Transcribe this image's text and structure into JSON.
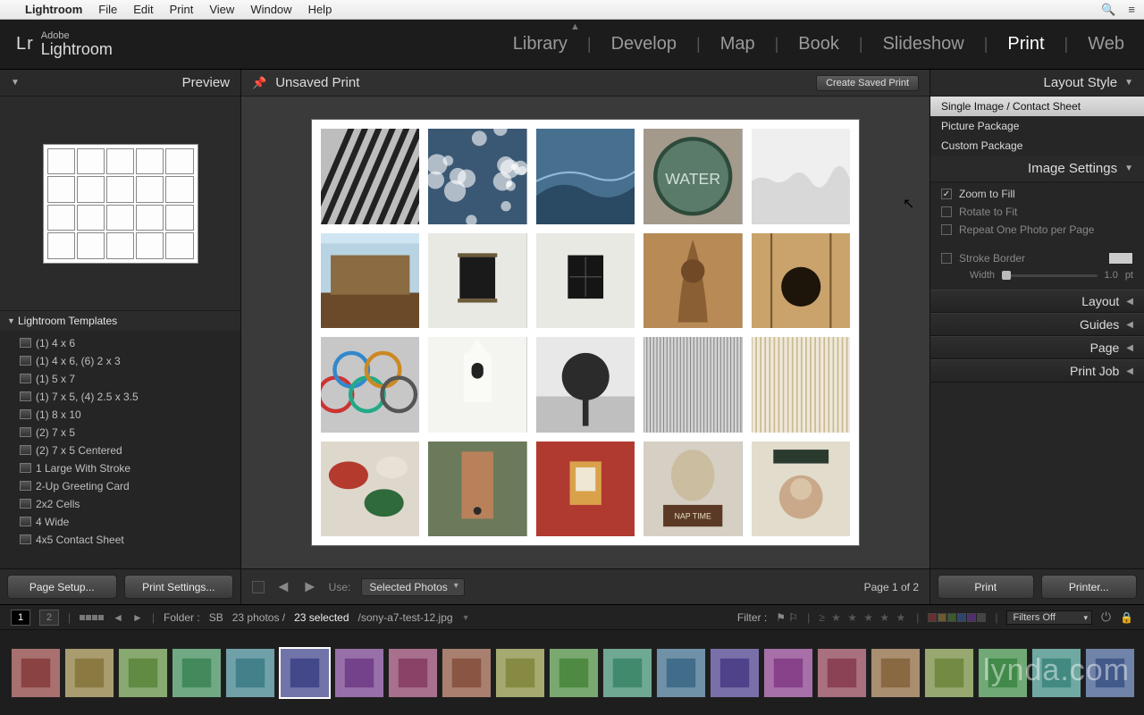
{
  "menubar": {
    "items": [
      "Lightroom",
      "File",
      "Edit",
      "Print",
      "View",
      "Window",
      "Help"
    ]
  },
  "app": {
    "adobe": "Adobe",
    "product": "Lightroom",
    "mark": "Lr"
  },
  "modules": [
    "Library",
    "Develop",
    "Map",
    "Book",
    "Slideshow",
    "Print",
    "Web"
  ],
  "modules_active": "Print",
  "left": {
    "preview_title": "Preview",
    "templates_group": "Lightroom Templates",
    "templates": [
      "(1) 4 x 6",
      "(1) 4 x 6, (6) 2 x 3",
      "(1) 5 x 7",
      "(1) 7 x 5, (4) 2.5 x 3.5",
      "(1) 8 x 10",
      "(2) 7 x 5",
      "(2) 7 x 5 Centered",
      "1 Large With Stroke",
      "2-Up Greeting Card",
      "2x2 Cells",
      "4 Wide",
      "4x5 Contact Sheet"
    ],
    "page_setup": "Page Setup...",
    "print_settings": "Print Settings..."
  },
  "center": {
    "doc_title": "Unsaved Print",
    "create_saved": "Create Saved Print",
    "use_label": "Use:",
    "use_value": "Selected Photos",
    "page_indicator": "Page 1 of 2"
  },
  "right": {
    "layout_style_title": "Layout Style",
    "layout_styles": [
      "Single Image / Contact Sheet",
      "Picture Package",
      "Custom Package"
    ],
    "layout_style_selected": 0,
    "image_settings_title": "Image Settings",
    "zoom_to_fill": "Zoom to Fill",
    "rotate_to_fit": "Rotate to Fit",
    "repeat_one": "Repeat One Photo per Page",
    "stroke_border": "Stroke Border",
    "width_label": "Width",
    "width_value": "1.0",
    "width_unit": "pt",
    "sections": [
      "Layout",
      "Guides",
      "Page",
      "Print Job"
    ],
    "print_btn": "Print",
    "printer_btn": "Printer..."
  },
  "filmstrip": {
    "folder_label": "Folder :",
    "folder_name": "SB",
    "count_text": "23 photos /",
    "selected_text": "23 selected",
    "filename": "/sony-a7-test-12.jpg",
    "filter_label": "Filter :",
    "filters_off": "Filters Off"
  },
  "watermark": "lynda.com"
}
